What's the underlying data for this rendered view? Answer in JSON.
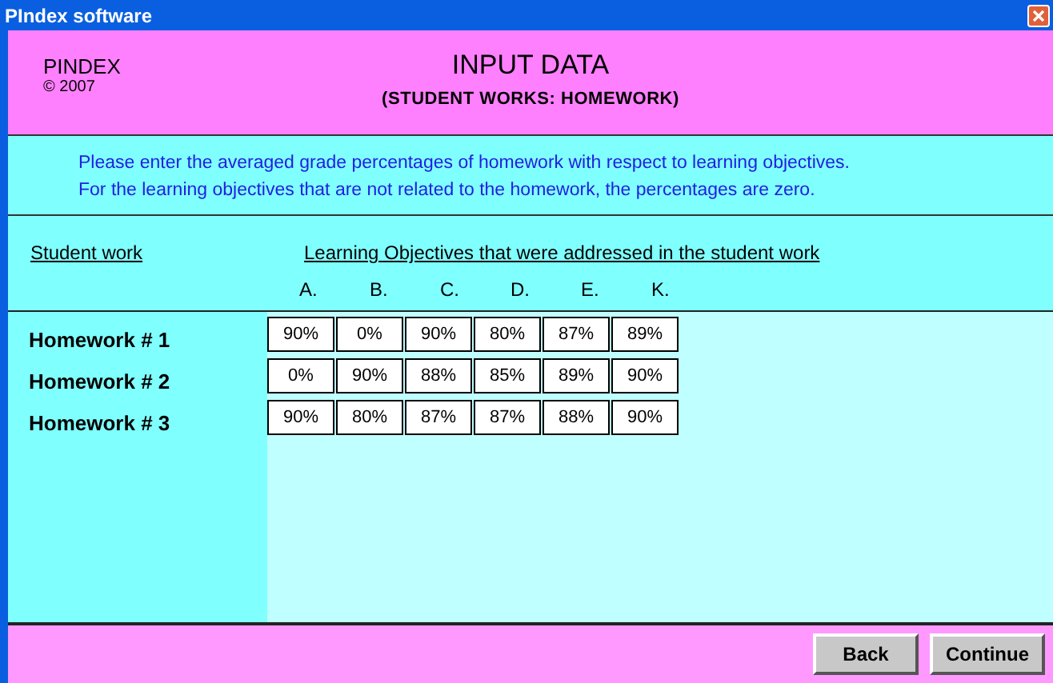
{
  "window": {
    "title": "PIndex software"
  },
  "header": {
    "brand": "PINDEX",
    "copyright": "© 2007",
    "title": "INPUT DATA",
    "subtitle": "(STUDENT WORKS: HOMEWORK)"
  },
  "instructions": [
    "Please enter the averaged grade percentages of homework with respect to learning objectives.",
    "For the learning objectives that are not related to the homework, the percentages are zero."
  ],
  "table": {
    "row_heading": "Student work",
    "column_heading": "Learning Objectives that were addressed in the student work",
    "columns": [
      "A.",
      "B.",
      "C.",
      "D.",
      "E.",
      "K."
    ],
    "rows": [
      {
        "label": "Homework # 1",
        "values": [
          "90%",
          "0%",
          "90%",
          "80%",
          "87%",
          "89%"
        ]
      },
      {
        "label": "Homework # 2",
        "values": [
          "0%",
          "90%",
          "88%",
          "85%",
          "89%",
          "90%"
        ]
      },
      {
        "label": "Homework # 3",
        "values": [
          "90%",
          "80%",
          "87%",
          "87%",
          "88%",
          "90%"
        ]
      }
    ]
  },
  "buttons": [
    "Back",
    "Continue"
  ]
}
